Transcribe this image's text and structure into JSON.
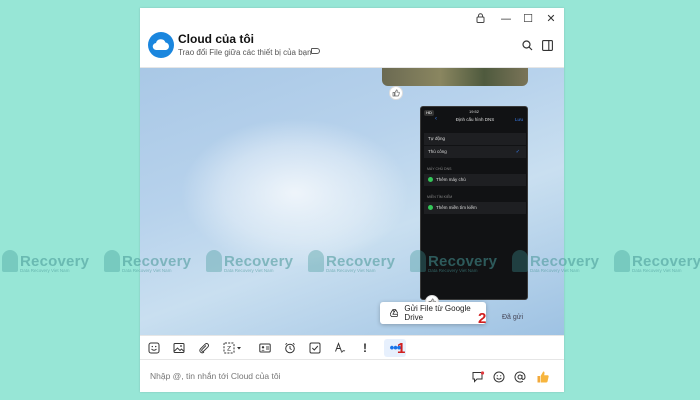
{
  "window": {
    "titlebar": {
      "pin_icon": "lock-icon",
      "min_glyph": "—",
      "max_glyph": "☐",
      "close_glyph": "✕"
    },
    "header": {
      "title": "Cloud của tôi",
      "subtitle": "Trao đổi File giữa các thiết bị của bạn",
      "avatar_icon": "cloud-icon"
    }
  },
  "chat": {
    "phone_screenshot": {
      "status_time": "19:52",
      "hd_badge": "HD",
      "nav_title": "Định cấu hình DNS",
      "nav_right": "Lưu",
      "rows": [
        {
          "label": "Tự động"
        },
        {
          "label": "Thủ công",
          "checked": true
        }
      ],
      "section_servers": "MÁY CHỦ DNS",
      "add_server": "Thêm máy chủ",
      "section_search": "MIỀN TÌM KIẾM",
      "add_domain": "Thêm miền tìm kiếm"
    },
    "sent_status": "Đã gửi"
  },
  "popup": {
    "label": "Gửi File từ Google Drive"
  },
  "toolbar": {
    "tools": [
      "sticker-icon",
      "image-icon",
      "attach-icon",
      "screenshot-icon",
      "contact-card-icon",
      "reminder-icon",
      "todo-icon",
      "font-format-icon",
      "urgent-icon",
      "more-icon"
    ],
    "urgent_glyph": "!",
    "more_glyph": "•••"
  },
  "input": {
    "placeholder": "Nhập @, tin nhắn tới Cloud của tôi"
  },
  "annotations": {
    "step1": "1",
    "step2": "2"
  },
  "watermark": {
    "text": "Recovery",
    "subtext": "Data Recovery Viet Nam"
  },
  "colors": {
    "accent": "#1a73e8",
    "background": "#97e6d6",
    "annotation": "#d11f1f"
  }
}
